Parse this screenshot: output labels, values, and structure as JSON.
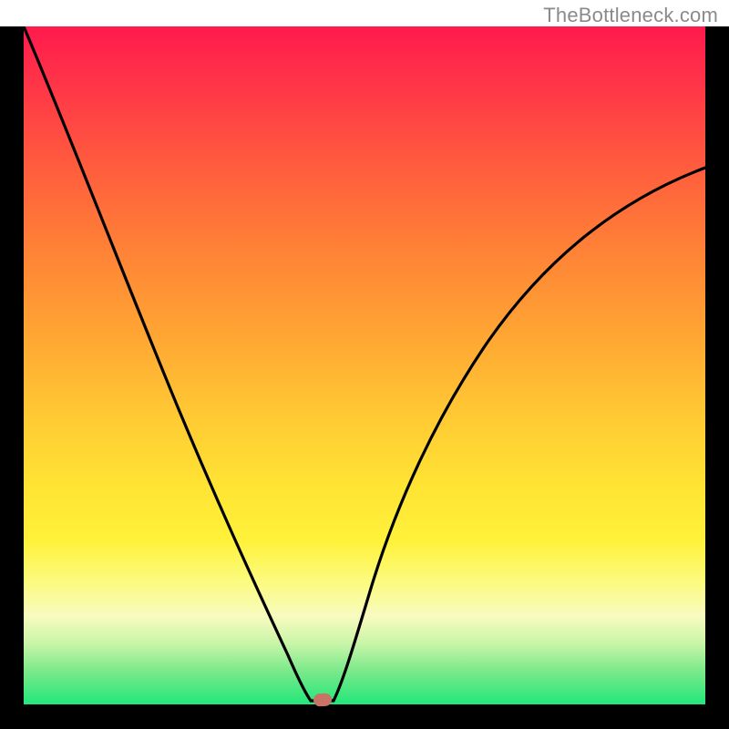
{
  "attribution": "TheBottleneck.com",
  "colors": {
    "frame": "#000000",
    "curve": "#000000",
    "marker": "#c97366",
    "gradient_stops": [
      "#ff1a4d",
      "#ff3348",
      "#ff5a3e",
      "#ff8236",
      "#ffa733",
      "#ffcb33",
      "#ffe433",
      "#fff23b",
      "#fbfb80",
      "#f8fbbf",
      "#c9f5a8",
      "#7ce98b",
      "#22e77a"
    ]
  },
  "chart_data": {
    "type": "line",
    "title": "",
    "xlabel": "",
    "ylabel": "",
    "xlim": [
      0,
      100
    ],
    "ylim": [
      0,
      100
    ],
    "grid": false,
    "legend": false,
    "series": [
      {
        "name": "left-branch",
        "x": [
          0,
          5,
          10,
          15,
          20,
          25,
          30,
          35,
          38,
          40,
          41,
          42
        ],
        "y": [
          100,
          90,
          79,
          67,
          55,
          42,
          30,
          18,
          9,
          3,
          1,
          0.5
        ]
      },
      {
        "name": "right-branch",
        "x": [
          45,
          47,
          50,
          55,
          60,
          65,
          70,
          75,
          80,
          85,
          90,
          95,
          100
        ],
        "y": [
          0.5,
          2,
          8,
          20,
          31,
          41,
          49,
          56,
          62,
          67,
          72,
          76,
          79
        ]
      }
    ],
    "annotations": [
      {
        "name": "flat-bottom",
        "x_range": [
          42,
          45
        ],
        "y": 0.5,
        "description": "short flat segment at minimum"
      },
      {
        "name": "marker",
        "shape": "rounded-rectangle",
        "x": 44,
        "y": 0.5,
        "color": "#c97366"
      }
    ]
  }
}
